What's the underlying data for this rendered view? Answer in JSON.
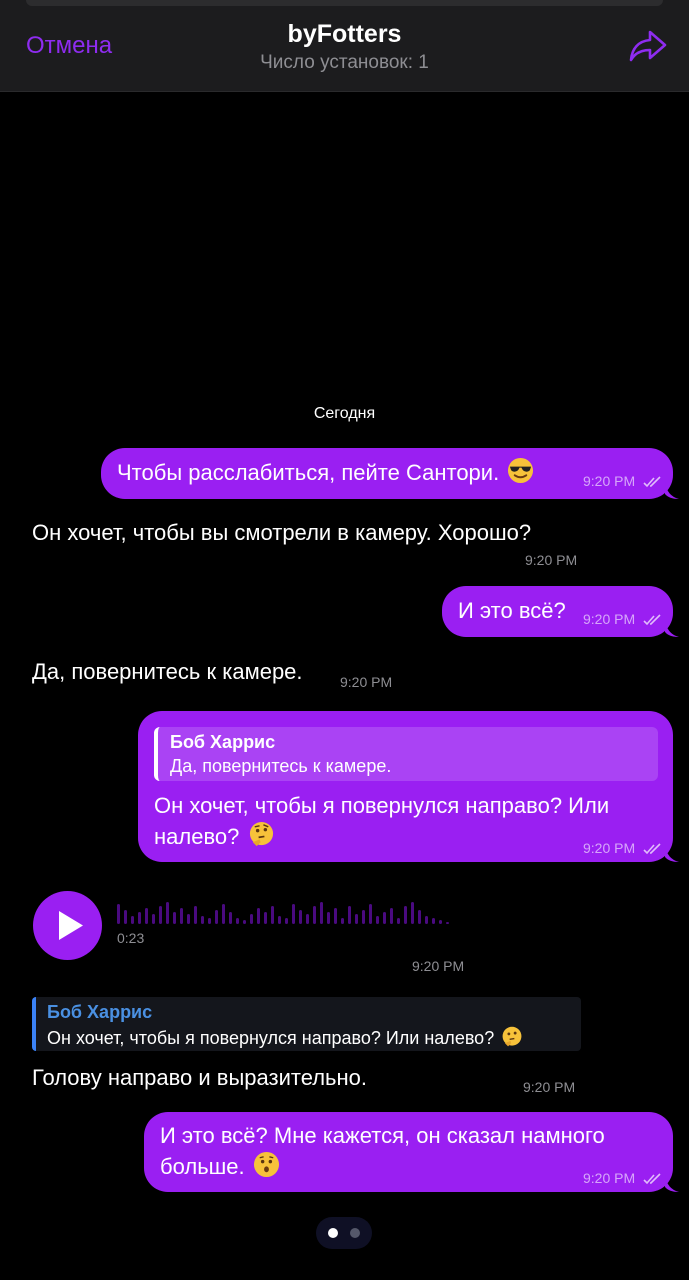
{
  "header": {
    "cancel_label": "Отмена",
    "title": "byFotters",
    "subtitle": "Число установок: 1",
    "share_icon": "share-forward-icon"
  },
  "date_separator": "Сегодня",
  "messages": [
    {
      "direction": "out",
      "text": "Чтобы расслабиться, пейте Сантори.",
      "emoji": "smiling-face-with-sunglasses",
      "time": "9:20 PM"
    },
    {
      "direction": "in",
      "text": "Он хочет, чтобы вы смотрели в камеру. Хорошо?",
      "time": "9:20 PM"
    },
    {
      "direction": "out",
      "text": "И это всё?",
      "time": "9:20 PM"
    },
    {
      "direction": "in",
      "text": "Да, повернитесь к камере.",
      "time": "9:20 PM"
    },
    {
      "direction": "out",
      "reply": {
        "name": "Боб Харрис",
        "text": "Да, повернитесь к камере."
      },
      "text_line1": "Он хочет, чтобы я повернулся направо? Или",
      "text_line2": "налево?",
      "emoji": "thinking-face",
      "time": "9:20 PM"
    },
    {
      "direction": "in",
      "type": "voice",
      "duration": "0:23",
      "time": "9:20 PM"
    },
    {
      "direction": "in",
      "reply": {
        "name": "Боб Харрис",
        "text": "Он хочет, чтобы я повернулся направо? Или налево?"
      },
      "text": "Голову направо и выразительно.",
      "time": "9:20 PM"
    },
    {
      "direction": "out",
      "text_line1": "И это всё? Мне кажется, он сказал намного",
      "text_line2": "больше.",
      "emoji": "hushed-face",
      "time": "9:20 PM"
    }
  ],
  "pager": {
    "pages": 2,
    "current": 1
  },
  "colors": {
    "accent": "#9a1ff2",
    "header_bg": "#1c1c1e",
    "background": "#000000",
    "quote_name_in": "#4a90e2"
  }
}
